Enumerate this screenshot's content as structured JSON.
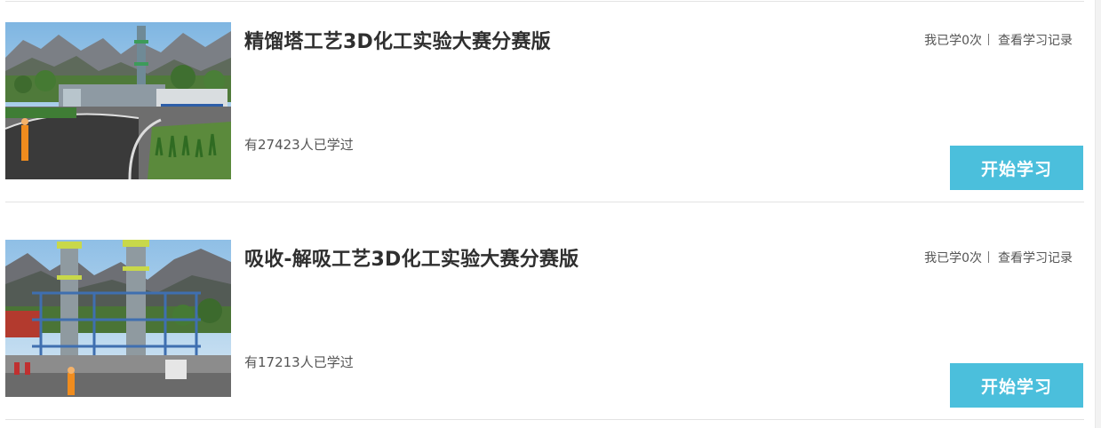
{
  "courses": [
    {
      "title": "精馏塔工艺3D化工实验大赛分赛版",
      "my_study": "我已学0次",
      "records_link": "查看学习记录",
      "learners": "有27423人已学过",
      "start_button": "开始学习"
    },
    {
      "title": "吸收-解吸工艺3D化工实验大赛分赛版",
      "my_study": "我已学0次",
      "records_link": "查看学习记录",
      "learners": "有17213人已学过",
      "start_button": "开始学习"
    }
  ],
  "colors": {
    "button_bg": "#4bbfdc",
    "title": "#2f2f2f",
    "divider": "#e3e3e3"
  }
}
